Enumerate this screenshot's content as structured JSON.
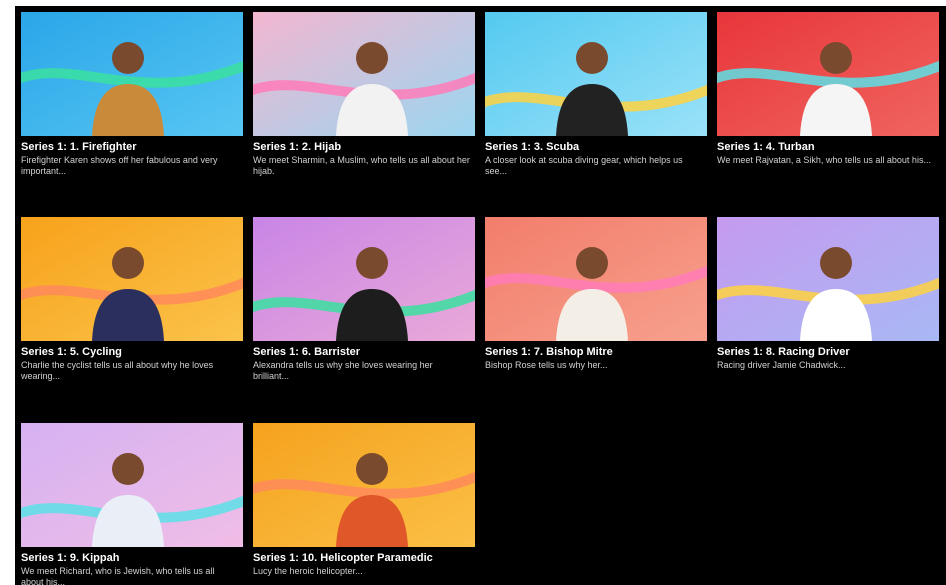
{
  "episodes": [
    {
      "title": "Series 1: 1. Firefighter",
      "description": "Firefighter Karen shows off her fabulous and very important...",
      "thumbnail": "firefighter-thumbnail",
      "bg": [
        "#2aa6e8",
        "#57c6f3"
      ]
    },
    {
      "title": "Series 1: 2. Hijab",
      "description": "We meet Sharmin, a Muslim, who tells us all about her hijab.",
      "thumbnail": "hijab-thumbnail",
      "bg": [
        "#f3b6d0",
        "#9ad6f0"
      ]
    },
    {
      "title": "Series 1: 3. Scuba",
      "description": "A closer look at scuba diving gear, which helps us see...",
      "thumbnail": "scuba-thumbnail",
      "bg": [
        "#54c9f0",
        "#9ae2f8"
      ]
    },
    {
      "title": "Series 1: 4. Turban",
      "description": "We meet Rajvatan, a Sikh, who tells us all about his...",
      "thumbnail": "turban-thumbnail",
      "bg": [
        "#e8363b",
        "#f0645f"
      ]
    },
    {
      "title": "Series 1: 5. Cycling",
      "description": "Charlie the cyclist tells us all about why he loves wearing...",
      "thumbnail": "cycling-thumbnail",
      "bg": [
        "#f7a21b",
        "#fbc34a"
      ]
    },
    {
      "title": "Series 1: 6. Barrister",
      "description": "Alexandra tells us why she loves wearing her brilliant...",
      "thumbnail": "barrister-thumbnail",
      "bg": [
        "#c985e6",
        "#e9a9d8"
      ]
    },
    {
      "title": "Series 1: 7. Bishop Mitre",
      "description": "Bishop Rose tells us why her...",
      "thumbnail": "bishop-mitre-thumbnail",
      "bg": [
        "#f27d6b",
        "#f7a08d"
      ]
    },
    {
      "title": "Series 1: 8. Racing Driver",
      "description": "Racing driver Jamie Chadwick...",
      "thumbnail": "racing-driver-thumbnail",
      "bg": [
        "#c59aef",
        "#a8b8f5"
      ]
    },
    {
      "title": "Series 1: 9. Kippah",
      "description": "We meet Richard, who is Jewish, who tells us all about his...",
      "thumbnail": "kippah-thumbnail",
      "bg": [
        "#d5b2f2",
        "#f0bde6"
      ]
    },
    {
      "title": "Series 1: 10. Helicopter Paramedic",
      "description": "Lucy the heroic helicopter...",
      "thumbnail": "helicopter-paramedic-thumbnail",
      "bg": [
        "#f5a21e",
        "#fbc046"
      ]
    }
  ]
}
